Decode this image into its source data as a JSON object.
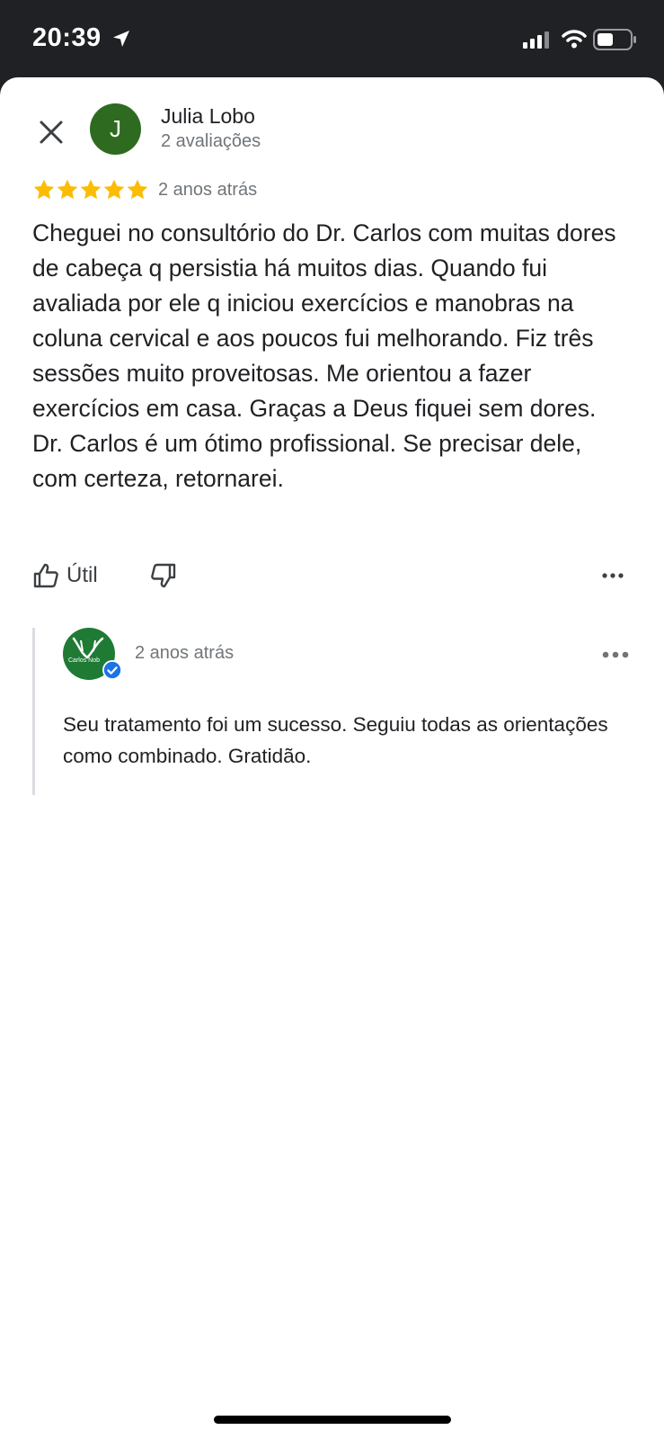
{
  "status_bar": {
    "time": "20:39",
    "icons": [
      "location-arrow-icon",
      "cellular-signal-icon",
      "wifi-icon",
      "battery-icon"
    ]
  },
  "review": {
    "close_icon": "close-icon",
    "avatar_letter": "J",
    "avatar_color": "#2e6b21",
    "reviewer_name": "Julia Lobo",
    "reviewer_reviews": "2 avaliações",
    "rating": 5,
    "rating_max": 5,
    "star_color": "#fbbc04",
    "time_ago": "2 anos atrás",
    "text": "Cheguei no consultório do Dr. Carlos com muitas dores de cabeça q persistia há muitos dias. Quando fui avaliada por ele q iniciou exercícios e manobras na coluna cervical e aos poucos fui melhorando. Fiz três sessões muito proveitosas. Me orientou a fazer exercícios em casa. Graças a Deus fiquei sem dores. Dr. Carlos é um ótimo profissional. Se precisar dele, com certeza, retornarei.",
    "helpful_label": "Útil"
  },
  "owner_reply": {
    "logo_text": "Carlos Nob",
    "time_ago": "2 anos atrás",
    "text": "Seu tratamento foi um sucesso. Seguiu todas as orientações como combinado. Gratidão.",
    "verified_color": "#1a73e8"
  }
}
